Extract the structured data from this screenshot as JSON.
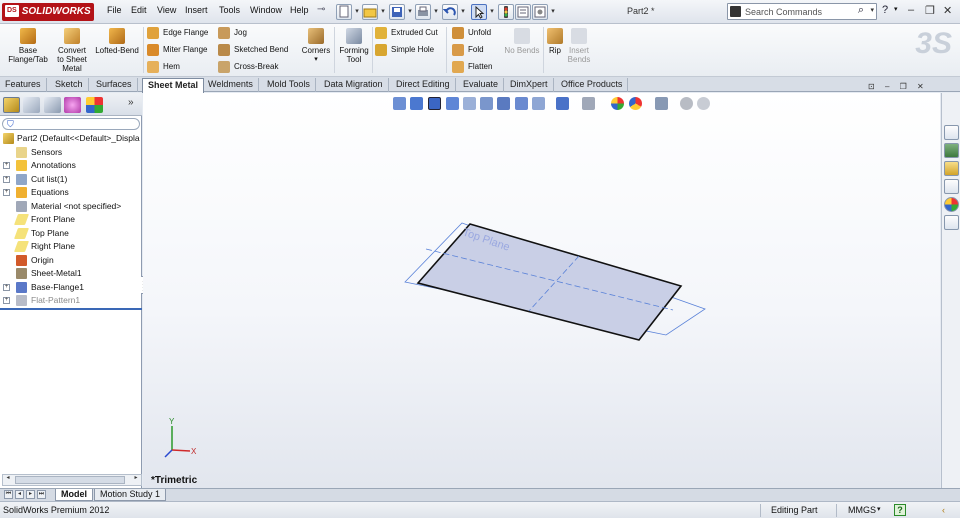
{
  "titlebar": {
    "app_logo": "SOLIDWORKS",
    "logo_mark": "DS",
    "menus": [
      "File",
      "Edit",
      "View",
      "Insert",
      "Tools",
      "Window",
      "Help"
    ],
    "document_title": "Part2 *",
    "search_placeholder": "Search Commands",
    "help_icon": "?"
  },
  "command_manager": {
    "big_buttons": [
      {
        "label": "Base Flange/Tab",
        "icon": "base-flange-icon"
      },
      {
        "label": "Convert to Sheet Metal",
        "icon": "convert-icon"
      },
      {
        "label": "Lofted-Bend",
        "icon": "lofted-bend-icon"
      }
    ],
    "col1": [
      "Edge Flange",
      "Miter Flange",
      "Hem"
    ],
    "col2": [
      "Jog",
      "Sketched Bend",
      "Cross-Break"
    ],
    "corners": "Corners",
    "forming_tool": "Forming Tool",
    "col3": [
      "Extruded Cut",
      "Simple Hole"
    ],
    "col4": [
      "Unfold",
      "Fold",
      "Flatten"
    ],
    "no_bends": "No Bends",
    "rip": "Rip",
    "insert_bends": "Insert Bends"
  },
  "tabs": [
    "Features",
    "Sketch",
    "Surfaces",
    "Sheet Metal",
    "Weldments",
    "Mold Tools",
    "Data Migration",
    "Direct Editing",
    "Evaluate",
    "DimXpert",
    "Office Products"
  ],
  "active_tab": "Sheet Metal",
  "tree": {
    "root": "Part2  (Default<<Default>_Displa",
    "items": [
      {
        "label": "Sensors",
        "expandable": false
      },
      {
        "label": "Annotations",
        "expandable": true
      },
      {
        "label": "Cut list(1)",
        "expandable": true
      },
      {
        "label": "Equations",
        "expandable": true
      },
      {
        "label": "Material <not specified>",
        "expandable": false
      },
      {
        "label": "Front Plane",
        "expandable": false
      },
      {
        "label": "Top Plane",
        "expandable": false
      },
      {
        "label": "Right Plane",
        "expandable": false
      },
      {
        "label": "Origin",
        "expandable": false
      },
      {
        "label": "Sheet-Metal1",
        "expandable": false
      },
      {
        "label": "Base-Flange1",
        "expandable": true
      },
      {
        "label": "Flat-Pattern1",
        "expandable": true,
        "suppressed": true
      }
    ]
  },
  "viewport": {
    "plane_label": "Top Plane",
    "view_orientation": "*Trimetric",
    "triad_labels": [
      "Y",
      "X"
    ]
  },
  "bottom_tabs": [
    "Model",
    "Motion Study 1"
  ],
  "active_bottom_tab": "Model",
  "statusbar": {
    "product": "SolidWorks Premium 2012",
    "mode": "Editing Part",
    "units": "MMGS",
    "help_icon": "?"
  },
  "colors": {
    "logo_red": "#b31217",
    "selection_blue": "#3a68b6",
    "plane_fill": "#c9cfe6"
  }
}
